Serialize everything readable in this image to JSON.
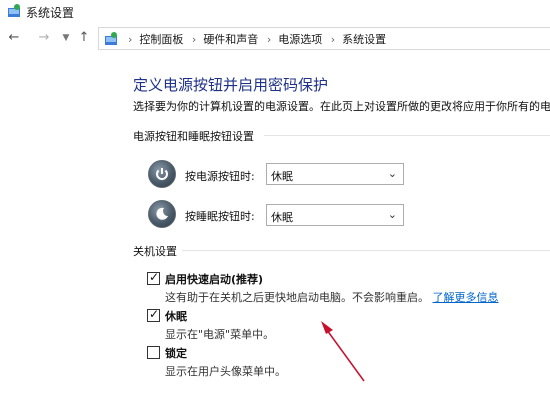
{
  "window": {
    "title": "系统设置",
    "icon": "control-panel-icon"
  },
  "nav": {
    "back_icon": "back-arrow-icon",
    "forward_icon": "forward-arrow-icon",
    "recent_icon": "chevron-down-icon",
    "up_icon": "up-arrow-icon",
    "breadcrumbs": [
      "控制面板",
      "硬件和声音",
      "电源选项",
      "系统设置"
    ]
  },
  "main": {
    "heading": "定义电源按钮并启用密码保护",
    "description": "选择要为你的计算机设置的电源设置。在此页上对设置所做的更改将应用于你所有的电",
    "buttons_section": {
      "title": "电源按钮和睡眠按钮设置",
      "rows": [
        {
          "label": "按电源按钮时:",
          "value": "休眠",
          "icon": "power-button-icon"
        },
        {
          "label": "按睡眠按钮时:",
          "value": "休眠",
          "icon": "sleep-button-icon"
        }
      ]
    },
    "shutdown_section": {
      "title": "关机设置",
      "items": [
        {
          "label": "启用快速启动(推荐)",
          "checked": true,
          "desc": "这有助于在关机之后更快地启动电脑。不会影响重启。",
          "link": "了解更多信息"
        },
        {
          "label": "休眠",
          "checked": true,
          "desc": "显示在\"电源\"菜单中。"
        },
        {
          "label": "锁定",
          "checked": false,
          "desc": "显示在用户头像菜单中。"
        }
      ]
    }
  },
  "colors": {
    "heading": "#1e3287",
    "link": "#0066cc",
    "annotation_arrow": "#c8102e"
  }
}
